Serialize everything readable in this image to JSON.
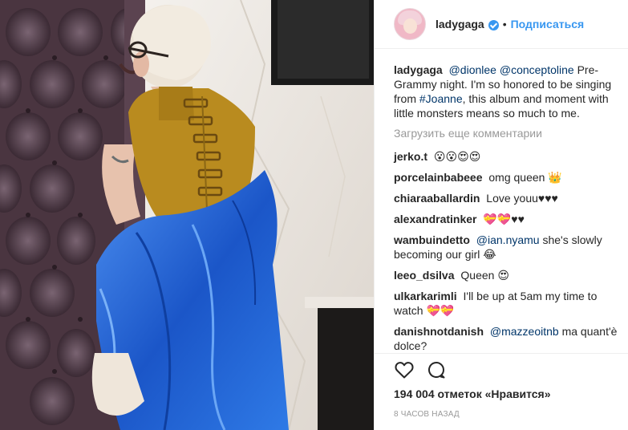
{
  "post": {
    "author": "ladygaga",
    "follow_label": "Подписаться",
    "separator": "•",
    "caption": {
      "username": "ladygaga",
      "mention_1": "@dionlee",
      "mention_2": "@conceptoline",
      "text_1": "Pre-Grammy night. I'm so honored to be singing from",
      "hashtag": "#Joanne",
      "text_2": ", this album and moment with little monsters means so much to me."
    },
    "load_more_label": "Загрузить еще комментарии",
    "comments": [
      {
        "username": "jerko.t",
        "mention": "",
        "text": "😮😮😍😍"
      },
      {
        "username": "porcelainbabeee",
        "mention": "",
        "text": "omg queen 👑"
      },
      {
        "username": "chiaraaballardin",
        "mention": "",
        "text": "Love youu♥♥♥"
      },
      {
        "username": "alexandratinker",
        "mention": "",
        "text": "💝💝♥♥"
      },
      {
        "username": "wambuindetto",
        "mention": "@ian.nyamu",
        "text": "she's slowly becoming our girl 😂"
      },
      {
        "username": "leeo_dsilva",
        "mention": "",
        "text": "Queen 😍"
      },
      {
        "username": "ulkarkarimli",
        "mention": "",
        "text": "I'll be up at 5am my time to watch 💝💝"
      },
      {
        "username": "danishnotdanish",
        "mention": "@mazzeoitnb",
        "text": "ma quant'è dolce?"
      }
    ],
    "likes_label": "194 004 отметок «Нравится»",
    "time_label": "8 часов назад",
    "icons": {
      "like": "heart-icon",
      "comment": "comment-icon",
      "verified": "verified-badge-icon"
    },
    "colors": {
      "accent": "#3897f0",
      "link": "#003569",
      "muted": "#999999"
    }
  }
}
